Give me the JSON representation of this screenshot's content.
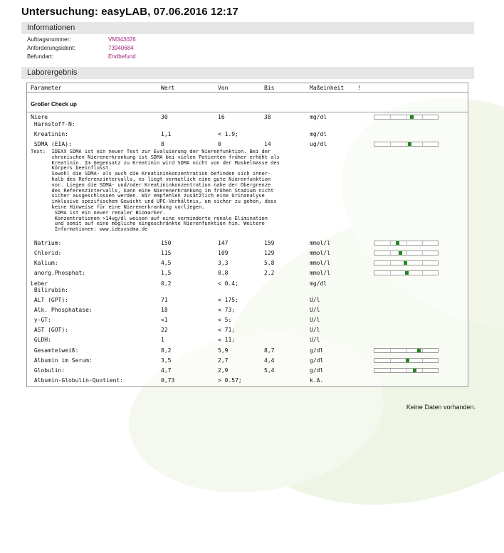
{
  "title": "Untersuchung: easyLAB, 07.06.2016 12:17",
  "sections": {
    "info_title": "Informationen",
    "lab_title": "Laborergebnis"
  },
  "info": [
    {
      "label": "Auftragsnummer:",
      "value": "VM343026"
    },
    {
      "label": "Anforderungsident:",
      "value": "73940684"
    },
    {
      "label": "Befundart:",
      "value": "Endbefund"
    }
  ],
  "table": {
    "headers": {
      "param": "Parameter",
      "wert": "Wert",
      "von": "Von",
      "bis": "Bis",
      "einheit": "Maßeinheit",
      "flag": "!"
    },
    "group": "Großer Check up",
    "rows": [
      {
        "param": "Niere",
        "wert": "30",
        "von": "16",
        "bis": "38",
        "einheit": "mg/dl",
        "marker": 0.58
      },
      {
        "param": " Harnstoff-N:",
        "wert": "",
        "von": "",
        "bis": "",
        "einheit": ""
      },
      {
        "param": " Kreatinin:",
        "wert": "1,1",
        "von": "< 1.9;",
        "bis": "",
        "einheit": "mg/dl"
      },
      {
        "param": " SDMA (EIA):",
        "wert": "8",
        "von": "0",
        "bis": "14",
        "einheit": "ug/dl",
        "marker": 0.55
      },
      {
        "param": " Natrium:",
        "wert": "150",
        "von": "147",
        "bis": "159",
        "einheit": "mmol/l",
        "marker": 0.36
      },
      {
        "param": " Chlorid:",
        "wert": "115",
        "von": "109",
        "bis": "129",
        "einheit": "mmol/l",
        "marker": 0.41
      },
      {
        "param": " Kalium:",
        "wert": "4,5",
        "von": "3,3",
        "bis": "5,8",
        "einheit": "mmol/l",
        "marker": 0.48
      },
      {
        "param": " anorg.Phosphat:",
        "wert": "1,5",
        "von": "0,8",
        "bis": "2,2",
        "einheit": "mmol/l",
        "marker": 0.5
      },
      {
        "param": "Leber",
        "wert": "0,2",
        "von": "< 0.4;",
        "bis": "",
        "einheit": "mg/dl"
      },
      {
        "param": " Bilirubin:",
        "wert": "",
        "von": "",
        "bis": "",
        "einheit": ""
      },
      {
        "param": " ALT (GPT):",
        "wert": "71",
        "von": "< 175;",
        "bis": "",
        "einheit": "U/l"
      },
      {
        "param": " Alk. Phosphatase:",
        "wert": "18",
        "von": "< 73;",
        "bis": "",
        "einheit": "U/l"
      },
      {
        "param": " y-GT:",
        "wert": "<1",
        "von": "< 5;",
        "bis": "",
        "einheit": "U/l"
      },
      {
        "param": " AST (GOT):",
        "wert": "22",
        "von": "< 71;",
        "bis": "",
        "einheit": "U/l"
      },
      {
        "param": " GLDH:",
        "wert": "1",
        "von": "< 11;",
        "bis": "",
        "einheit": "U/l"
      },
      {
        "param": " Gesamteiweiß:",
        "wert": "8,2",
        "von": "5,9",
        "bis": "8,7",
        "einheit": "g/dl",
        "marker": 0.7
      },
      {
        "param": " Albumin im Serum:",
        "wert": "3,5",
        "von": "2,7",
        "bis": "4,4",
        "einheit": "g/dl",
        "marker": 0.52
      },
      {
        "param": " Globulin:",
        "wert": "4,7",
        "von": "2,9",
        "bis": "5,4",
        "einheit": "g/dl",
        "marker": 0.63
      },
      {
        "param": " Albumin-Globulin-Quotient:",
        "wert": "0,73",
        "von": "> 0.57;",
        "bis": "",
        "einheit": "k.A."
      }
    ],
    "text_block": "Text:  IDEXX SDMA ist ein neuer Test zur Evaluierung der Nierenfunktion. Bei der\n       chronischen Nierenerkrankung ist SDMA bei vielen Patienten früher erhöht als\n       Kreatinin. Im Gegensatz zu Kreatinin wird SDMA nicht von der Muskelmasse des\n       Körpers beeinflusst.\n       Sowohl die SDMA- als auch die Kreatininkonzentration befinden sich inner-\n       halb des Referenzintervalls, es liegt vermutlich eine gute Nierenfunktion\n       vor. Liegen die SDMA- und/oder Kreatininkonzentration nahe der Obergrenze\n       des Referenzintervalls, kann eine Nierenerkrankung im frühen Stadium nicht\n       sicher ausgeschlossen werden. Wir empfehlen zusätzlich eine Urinanalyse\n       inklusive spezifischem Gewicht und UPC-Verhältnis, um sicher zu gehen, dass\n       keine Hinweise für eine Nierenerkrankung vorliegen.\n        SDMA ist ein neuer renaler Biomarker.\n        Konzentrationen >14ug/dl weisen auf eine verminderte renale Elimination\n        und somit auf eine mögliche eingeschränkte Nierenfunktion hin. Weitere\n        Informationen: www.idexxsdma.de"
  },
  "footer": "Keine Daten vorhanden.",
  "colors": {
    "link_value": "#a0247b",
    "marker": "#1e8a1e",
    "section_bg": "#e6e6e6"
  }
}
